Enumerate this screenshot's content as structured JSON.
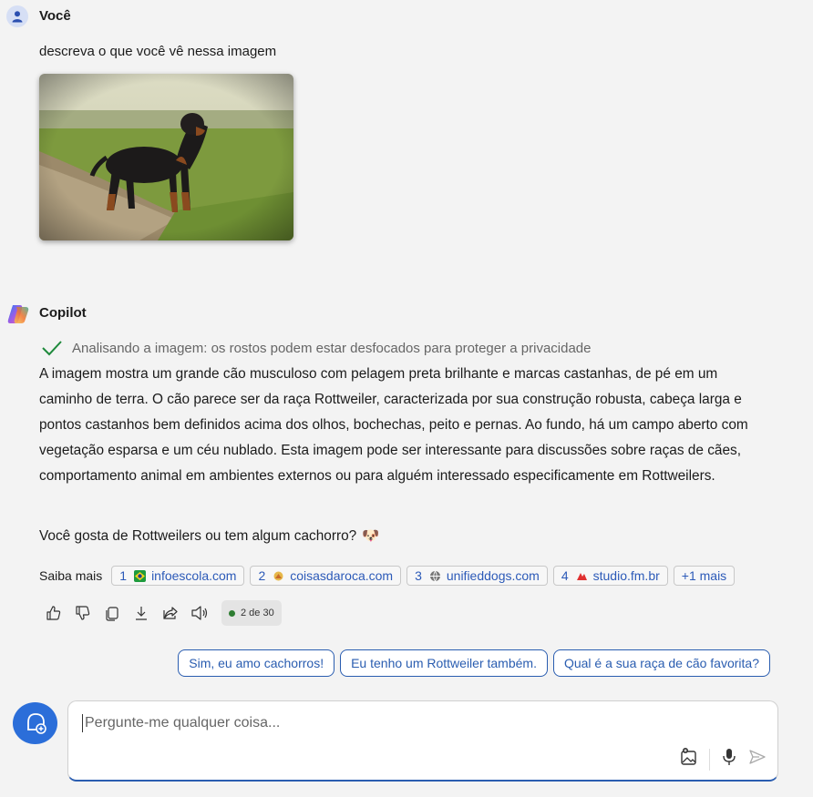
{
  "user": {
    "name": "Você",
    "message": "descreva o que você vê nessa imagem"
  },
  "assistant": {
    "name": "Copilot",
    "status": "Analisando a imagem: os rostos podem estar desfocados para proteger a privacidade",
    "answer": "A imagem mostra um grande cão musculoso com pelagem preta brilhante e marcas castanhas, de pé em um caminho de terra. O cão parece ser da raça Rottweiler, caracterizada por sua construção robusta, cabeça larga e pontos castanhos bem definidos acima dos olhos, bochechas, peito e pernas. Ao fundo, há um campo aberto com vegetação esparsa e um céu nublado. Esta imagem pode ser interessante para discussões sobre raças de cães, comportamento animal em ambientes externos ou para alguém interessado especificamente em Rottweilers.",
    "question": "Você gosta de Rottweilers ou tem algum cachorro?",
    "question_emoji": "🐶"
  },
  "learn_more": {
    "label": "Saiba mais",
    "sources": [
      {
        "num": "1",
        "site": "infoescola.com"
      },
      {
        "num": "2",
        "site": "coisasdaroca.com"
      },
      {
        "num": "3",
        "site": "unifieddogs.com"
      },
      {
        "num": "4",
        "site": "studio.fm.br"
      }
    ],
    "more": "+1 mais"
  },
  "pager": {
    "text": "2 de 30"
  },
  "suggestions": [
    "Sim, eu amo cachorros!",
    "Eu tenho um Rottweiler também.",
    "Qual é a sua raça de cão favorita?"
  ],
  "composer": {
    "placeholder": "Pergunte-me qualquer coisa..."
  },
  "colors": {
    "accent": "#2a5db0",
    "background": "#f3f3f3"
  }
}
